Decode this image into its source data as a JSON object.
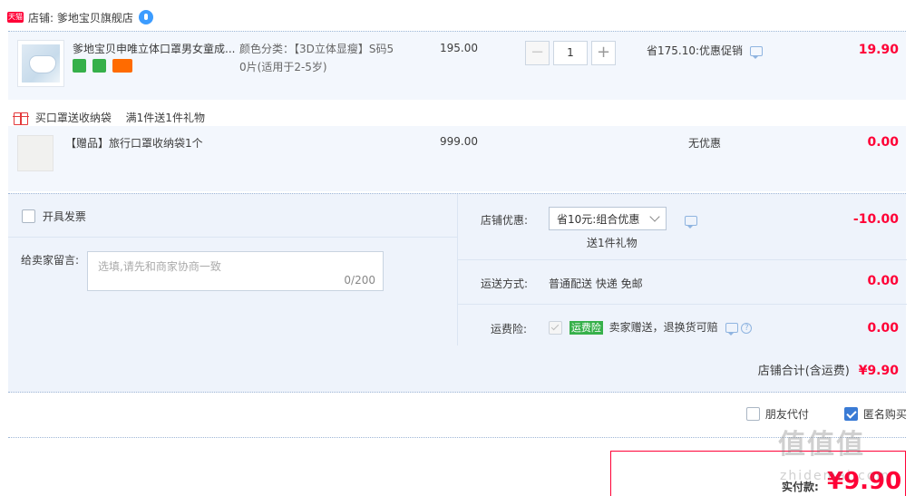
{
  "shop": {
    "badge": "天猫",
    "label": "店铺: 爹地宝贝旗舰店"
  },
  "item": {
    "title": "爹地宝贝申唯立体口罩男女童成...",
    "sku_label": "颜色分类：【3D立体显瘦】S码5",
    "sku_line2": "0片(适用于2-5岁)",
    "price": "195.00",
    "quantity": "1",
    "minus": "−",
    "plus": "+",
    "promo": "省175.10:优惠促销",
    "subtotal": "19.90"
  },
  "gift": {
    "header": "买口罩送收纳袋",
    "header_rule": "满1件送1件礼物",
    "title": "【赠品】旅行口罩收纳袋1个",
    "price": "999.00",
    "discount": "无优惠",
    "subtotal": "0.00"
  },
  "extras": {
    "invoice_label": "开具发票",
    "memo_label": "给卖家留言:",
    "memo_placeholder": "选填,请先和商家协商一致",
    "memo_count": "0/200",
    "shop_discount_label": "店铺优惠:",
    "shop_discount_value": "省10元:组合优惠",
    "shop_discount_note": "送1件礼物",
    "shop_discount_amount": "-10.00",
    "shipping_label": "运送方式:",
    "shipping_value": "普通配送 快递 免邮",
    "shipping_amount": "0.00",
    "insurance_label": "运费险:",
    "insurance_tag": "运费险",
    "insurance_desc": "卖家赠送，退换货可赔",
    "insurance_amount": "0.00"
  },
  "totals": {
    "shop_total_label": "店铺合计(含运费)",
    "shop_total_value": "¥9.90"
  },
  "options": {
    "friend_pay": "朋友代付",
    "anonymous": "匿名购买"
  },
  "final": {
    "label": "实付款:",
    "value": "¥9.90"
  },
  "watermark": {
    "logo": "值值值",
    "site": "zhidemai.com"
  },
  "colors": {
    "accent_red": "#ff0036",
    "row_bg": "#f3f7fd",
    "link_blue": "#3a7bd5"
  }
}
